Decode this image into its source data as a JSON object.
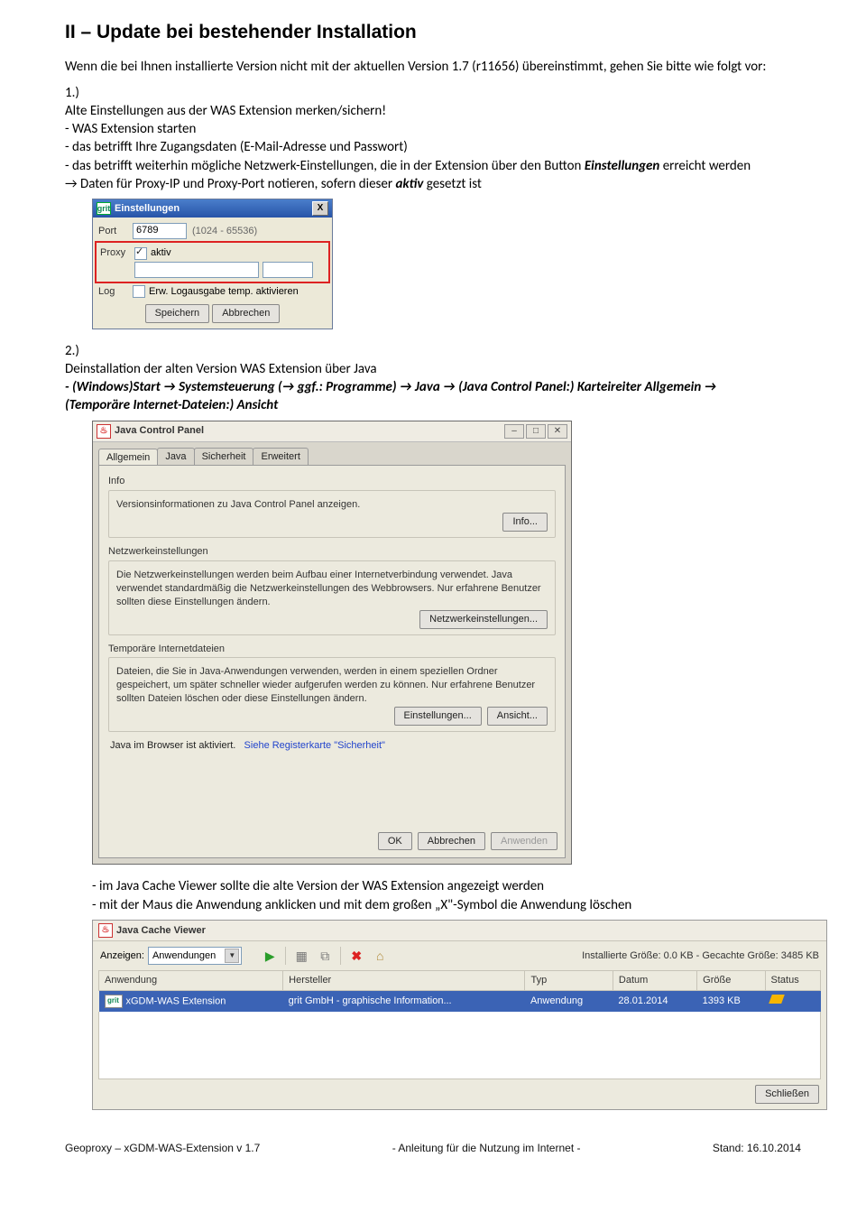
{
  "heading": "II – Update bei bestehender Installation",
  "intro": "Wenn die bei Ihnen installierte Version nicht mit der aktuellen Version 1.7 (r11656) übereinstimmt, gehen Sie bitte wie folgt vor:",
  "item1": {
    "marker": "1.)",
    "title": "Alte Einstellungen aus der WAS Extension merken/sichern!",
    "l1": "- WAS Extension starten",
    "l2": "- das betrifft Ihre Zugangsdaten (E-Mail-Adresse und Passwort)",
    "l3_pre": "- das betrifft weiterhin mögliche Netzwerk-Einstellungen, die in der Extension über den Button ",
    "l3_b": "Einstellungen",
    "l3_post": " erreicht werden",
    "l4_pre": " → Daten für Proxy-IP und Proxy-Port notieren, sofern dieser ",
    "l4_b": "aktiv",
    "l4_post": " gesetzt ist"
  },
  "dlg1": {
    "title": "Einstellungen",
    "icon_text": "grit",
    "close": "X",
    "port_label": "Port",
    "port_value": "6789",
    "port_hint": "(1024 - 65536)",
    "proxy_label": "Proxy",
    "proxy_cb": "aktiv",
    "log_label": "Log",
    "log_cb": "Erw. Logausgabe temp. aktivieren",
    "btn_save": "Speichern",
    "btn_cancel": "Abbrechen"
  },
  "item2": {
    "marker": "2.)",
    "title": "Deinstallation der alten Version WAS Extension über Java",
    "path_pre": "- (Windows)Start → Systemsteuerung (→ ggf.: Programme) → Java → (Java Control Panel:) Karteireiter Allgemein → (Temporäre Internet-Dateien:) Ansicht"
  },
  "jcp": {
    "title": "Java Control Panel",
    "tabs": [
      "Allgemein",
      "Java",
      "Sicherheit",
      "Erweitert"
    ],
    "grp_info_title": "Info",
    "grp_info_desc": "Versionsinformationen zu Java Control Panel anzeigen.",
    "btn_info": "Info...",
    "grp_net_title": "Netzwerkeinstellungen",
    "grp_net_desc": "Die Netzwerkeinstellungen werden beim Aufbau einer Internetverbindung verwendet. Java verwendet standardmäßig die Netzwerkeinstellungen des Webbrowsers. Nur erfahrene Benutzer sollten diese Einstellungen ändern.",
    "btn_net": "Netzwerkeinstellungen...",
    "grp_tmp_title": "Temporäre Internetdateien",
    "grp_tmp_desc": "Dateien, die Sie in Java-Anwendungen verwenden, werden in einem speziellen Ordner gespeichert, um später schneller wieder aufgerufen werden zu können. Nur erfahrene Benutzer sollten Dateien löschen oder diese Einstellungen ändern.",
    "btn_settings": "Einstellungen...",
    "btn_view": "Ansicht...",
    "browser_pre": "Java im Browser ist aktiviert.",
    "browser_link": "Siehe Registerkarte \"Sicherheit\"",
    "btn_ok": "OK",
    "btn_cancel": "Abbrechen",
    "btn_apply": "Anwenden"
  },
  "after_jcp": {
    "l1": "- im Java Cache Viewer sollte die alte Version der WAS Extension angezeigt werden",
    "l2": "- mit der Maus die Anwendung anklicken und mit dem großen „X\"-Symbol die Anwendung löschen"
  },
  "jcv": {
    "title": "Java Cache Viewer",
    "show_label": "Anzeigen:",
    "show_value": "Anwendungen",
    "status": "Installierte Größe:  0.0 KB - Gecachte Größe:  3485 KB",
    "headers": [
      "Anwendung",
      "Hersteller",
      "Typ",
      "Datum",
      "Größe",
      "Status"
    ],
    "row": {
      "app": "xGDM-WAS Extension",
      "vendor": "grit GmbH - graphische Information...",
      "type": "Anwendung",
      "date": "28.01.2014",
      "size": "1393 KB"
    },
    "btn_close": "Schließen"
  },
  "footer": {
    "left": "Geoproxy – xGDM-WAS-Extension v 1.7",
    "mid": "- Anleitung für die Nutzung im Internet -",
    "right": "Stand: 16.10.2014"
  }
}
